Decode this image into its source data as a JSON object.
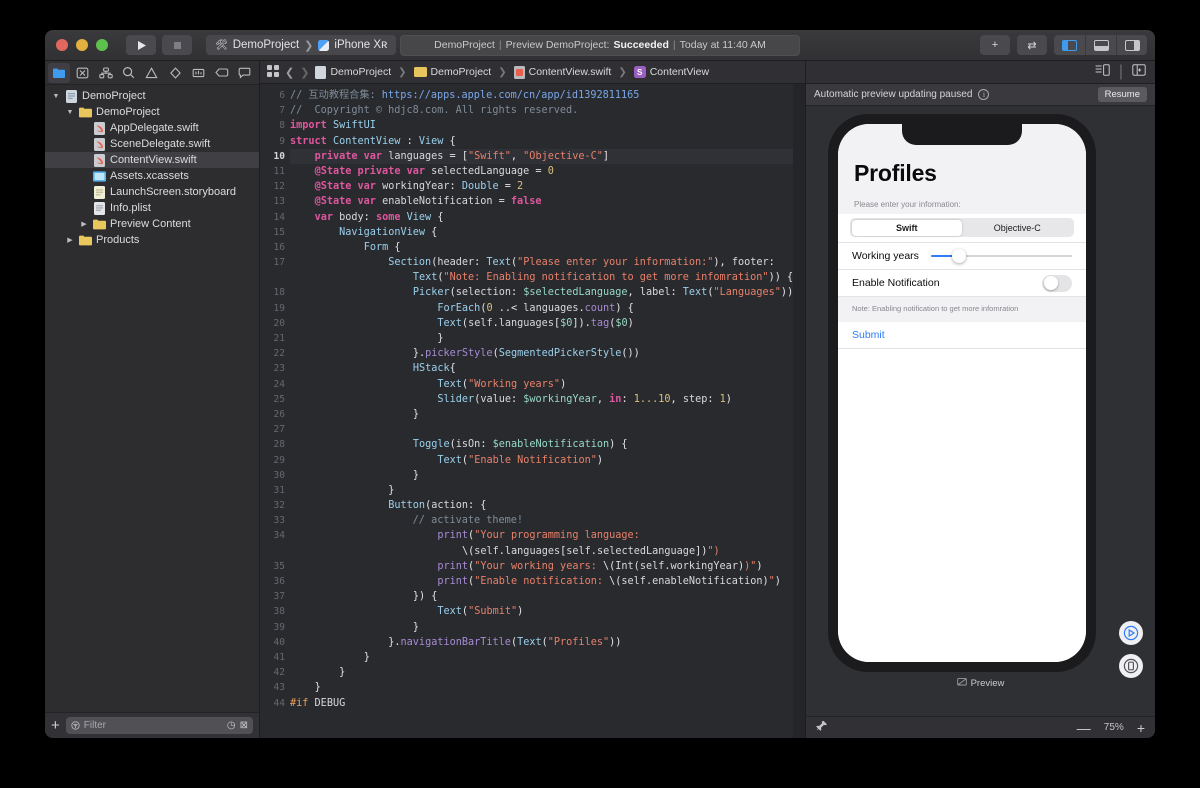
{
  "titlebar": {
    "run_icon": "▶",
    "stop_icon": "■",
    "scheme_project": "DemoProject",
    "scheme_separator": "❯",
    "scheme_device": "iPhone Xʀ",
    "status": {
      "project": "DemoProject",
      "pipe": "|",
      "action": "Preview DemoProject:",
      "result": "Succeeded",
      "time": "Today at 11:40 AM"
    },
    "add_label": "+",
    "toggle_label": "⇄",
    "panel_left": "left-panel-toggle",
    "panel_bottom": "bottom-panel-toggle",
    "panel_right": "right-panel-toggle"
  },
  "navigator": {
    "tabs": [
      {
        "name": "project-navigator",
        "icon": "folder-icon",
        "active": true
      },
      {
        "name": "source-control-navigator",
        "icon": "source-control-icon",
        "active": false
      },
      {
        "name": "symbol-navigator",
        "icon": "symbol-icon",
        "active": false
      },
      {
        "name": "find-navigator",
        "icon": "search-icon",
        "active": false
      },
      {
        "name": "issue-navigator",
        "icon": "warning-icon",
        "active": false
      },
      {
        "name": "test-navigator",
        "icon": "diamond-icon",
        "active": false
      },
      {
        "name": "debug-navigator",
        "icon": "gauge-icon",
        "active": false
      },
      {
        "name": "breakpoint-navigator",
        "icon": "tag-icon",
        "active": false
      },
      {
        "name": "report-navigator",
        "icon": "message-icon",
        "active": false
      }
    ],
    "tree": [
      {
        "label": "DemoProject",
        "depth": 0,
        "twisty": "▼",
        "icon": "project-icon",
        "selected": false
      },
      {
        "label": "DemoProject",
        "depth": 1,
        "twisty": "▼",
        "icon": "folder-icon",
        "selected": false
      },
      {
        "label": "AppDelegate.swift",
        "depth": 2,
        "twisty": "",
        "icon": "swift-file-icon",
        "selected": false
      },
      {
        "label": "SceneDelegate.swift",
        "depth": 2,
        "twisty": "",
        "icon": "swift-file-icon",
        "selected": false
      },
      {
        "label": "ContentView.swift",
        "depth": 2,
        "twisty": "",
        "icon": "swift-file-icon",
        "selected": true
      },
      {
        "label": "Assets.xcassets",
        "depth": 2,
        "twisty": "",
        "icon": "assets-icon",
        "selected": false
      },
      {
        "label": "LaunchScreen.storyboard",
        "depth": 2,
        "twisty": "",
        "icon": "storyboard-icon",
        "selected": false
      },
      {
        "label": "Info.plist",
        "depth": 2,
        "twisty": "",
        "icon": "plist-icon",
        "selected": false
      },
      {
        "label": "Preview Content",
        "depth": 2,
        "twisty": "▶",
        "icon": "folder-icon",
        "selected": false
      },
      {
        "label": "Products",
        "depth": 1,
        "twisty": "▶",
        "icon": "folder-icon",
        "selected": false
      }
    ],
    "bottom": {
      "add_label": "+",
      "filter_placeholder": "Filter",
      "filter_value": "",
      "recent_icon": "clock-icon",
      "sourcecontrol_icon": "filter-status-icon"
    }
  },
  "editor": {
    "jumpbar": {
      "grid_icon": "related-items-icon",
      "back": "❮",
      "forward": "❯",
      "crumbs": [
        "DemoProject",
        "DemoProject",
        "ContentView.swift",
        "ContentView"
      ],
      "symbol_badge": "S"
    },
    "first_line_number": 6,
    "current_line": 10,
    "lines": [
      {
        "n": 6,
        "text": "// 互动教程合集: https://apps.apple.com/cn/app/id1392811165"
      },
      {
        "n": 7,
        "text": "//  Copyright © hdjc8.com. All rights reserved."
      },
      {
        "n": 8,
        "text": "import SwiftUI"
      },
      {
        "n": 9,
        "text": "struct ContentView : View {"
      },
      {
        "n": 10,
        "text": "    private var languages = [\"Swift\", \"Objective-C\"]"
      },
      {
        "n": 11,
        "text": "    @State private var selectedLanguage = 0"
      },
      {
        "n": 12,
        "text": "    @State var workingYear: Double = 2"
      },
      {
        "n": 13,
        "text": "    @State var enableNotification = false"
      },
      {
        "n": 14,
        "text": "    var body: some View {"
      },
      {
        "n": 15,
        "text": "        NavigationView {"
      },
      {
        "n": 16,
        "text": "            Form {"
      },
      {
        "n": 17,
        "text": "                Section(header: Text(\"Please enter your information:\"), footer:"
      },
      {
        "n": "",
        "text": "                    Text(\"Note: Enabling notification to get more infomration\")) {"
      },
      {
        "n": 18,
        "text": "                    Picker(selection: $selectedLanguage, label: Text(\"Languages\")) {"
      },
      {
        "n": 19,
        "text": "                        ForEach(0 ..< languages.count) {"
      },
      {
        "n": 20,
        "text": "                        Text(self.languages[$0]).tag($0)"
      },
      {
        "n": 21,
        "text": "                        }"
      },
      {
        "n": 22,
        "text": "                    }.pickerStyle(SegmentedPickerStyle())"
      },
      {
        "n": 23,
        "text": "                    HStack{"
      },
      {
        "n": 24,
        "text": "                        Text(\"Working years\")"
      },
      {
        "n": 25,
        "text": "                        Slider(value: $workingYear, in: 1...10, step: 1)"
      },
      {
        "n": 26,
        "text": "                    }"
      },
      {
        "n": 27,
        "text": ""
      },
      {
        "n": 28,
        "text": "                    Toggle(isOn: $enableNotification) {"
      },
      {
        "n": 29,
        "text": "                        Text(\"Enable Notification\")"
      },
      {
        "n": 30,
        "text": "                    }"
      },
      {
        "n": 31,
        "text": "                }"
      },
      {
        "n": 32,
        "text": "                Button(action: {"
      },
      {
        "n": 33,
        "text": "                    // activate theme!"
      },
      {
        "n": 34,
        "text": "                        print(\"Your programming language:"
      },
      {
        "n": "",
        "text": "                            \\(self.languages[self.selectedLanguage])\")"
      },
      {
        "n": 35,
        "text": "                        print(\"Your working years: \\(Int(self.workingYear))\")"
      },
      {
        "n": 36,
        "text": "                        print(\"Enable notification: \\(self.enableNotification)\")"
      },
      {
        "n": 37,
        "text": "                    }) {"
      },
      {
        "n": 38,
        "text": "                        Text(\"Submit\")"
      },
      {
        "n": 39,
        "text": "                    }"
      },
      {
        "n": 40,
        "text": "                }.navigationBarTitle(Text(\"Profiles\"))"
      },
      {
        "n": 41,
        "text": "            }"
      },
      {
        "n": 42,
        "text": "        }"
      },
      {
        "n": 43,
        "text": "    }"
      },
      {
        "n": 44,
        "text": "#if DEBUG"
      }
    ]
  },
  "preview": {
    "tabbar": {
      "inspector_icon": "editor-options-icon",
      "add_editor_icon": "add-editor-icon"
    },
    "notice_text": "Automatic preview updating paused",
    "info_icon": "ⓘ",
    "resume_label": "Resume",
    "device": {
      "nav_title": "Profiles",
      "section_header": "Please enter your information:",
      "segments": [
        {
          "label": "Swift",
          "selected": true
        },
        {
          "label": "Objective-C",
          "selected": false
        }
      ],
      "slider_row_label": "Working years",
      "slider_value": 2,
      "slider_min": 1,
      "slider_max": 10,
      "toggle_row_label": "Enable Notification",
      "toggle_on": false,
      "section_footer": "Note: Enabling notification to get more infomration",
      "submit_label": "Submit"
    },
    "side_buttons": [
      {
        "name": "live-preview-button",
        "icon": "play-circle-icon"
      },
      {
        "name": "preview-on-device-button",
        "icon": "device-circle-icon"
      }
    ],
    "canvas_label": "Preview",
    "canvas_label_icon": "preview-icon",
    "bottom": {
      "pin_icon": "pin-icon",
      "zoom_out": "—",
      "zoom_level": "75%",
      "zoom_in": "+"
    }
  }
}
